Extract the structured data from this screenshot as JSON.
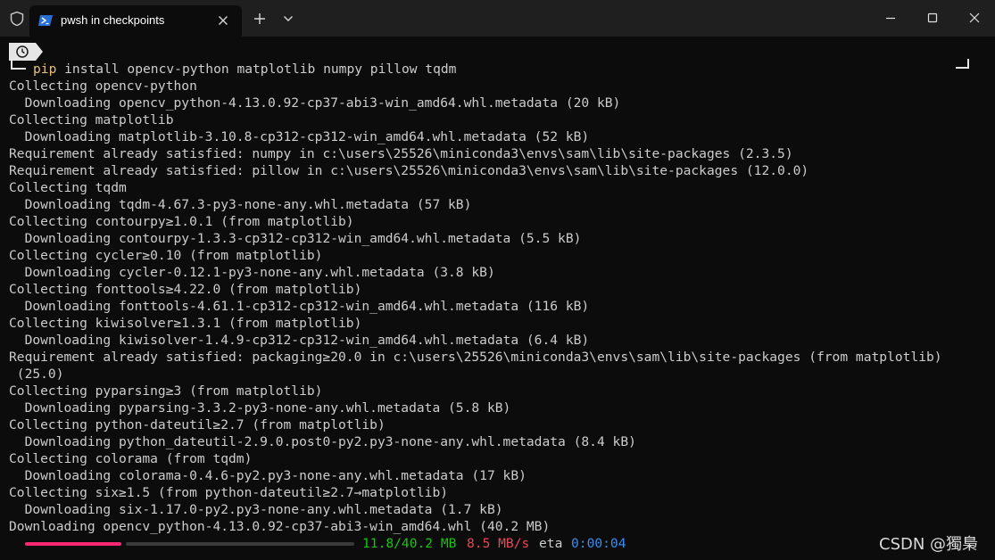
{
  "window": {
    "tab_title": "pwsh in checkpoints"
  },
  "icons": {
    "shield": "shield-icon",
    "tab": "powershell-icon",
    "tab_close": "close-icon",
    "new_tab": "plus-icon",
    "dropdown": "chevron-down-icon",
    "minimize": "minimize-icon",
    "maximize": "maximize-icon",
    "close": "close-icon",
    "prompt": "clock-icon"
  },
  "colors": {
    "background": "#0c0c0c",
    "titlebar": "#1f1f1f",
    "text": "#cccccc",
    "command_keyword": "#e5c07b",
    "progress_done": "#f92672",
    "downloaded": "#16c60c",
    "speed": "#e74856",
    "eta": "#3b8eea"
  },
  "terminal": {
    "command_keyword": "pip",
    "command_rest": " install opencv-python matplotlib numpy pillow tqdm",
    "lines": [
      "Collecting opencv-python",
      "  Downloading opencv_python-4.13.0.92-cp37-abi3-win_amd64.whl.metadata (20 kB)",
      "Collecting matplotlib",
      "  Downloading matplotlib-3.10.8-cp312-cp312-win_amd64.whl.metadata (52 kB)",
      "Requirement already satisfied: numpy in c:\\users\\25526\\miniconda3\\envs\\sam\\lib\\site-packages (2.3.5)",
      "Requirement already satisfied: pillow in c:\\users\\25526\\miniconda3\\envs\\sam\\lib\\site-packages (12.0.0)",
      "Collecting tqdm",
      "  Downloading tqdm-4.67.3-py3-none-any.whl.metadata (57 kB)",
      "Collecting contourpy≥1.0.1 (from matplotlib)",
      "  Downloading contourpy-1.3.3-cp312-cp312-win_amd64.whl.metadata (5.5 kB)",
      "Collecting cycler≥0.10 (from matplotlib)",
      "  Downloading cycler-0.12.1-py3-none-any.whl.metadata (3.8 kB)",
      "Collecting fonttools≥4.22.0 (from matplotlib)",
      "  Downloading fonttools-4.61.1-cp312-cp312-win_amd64.whl.metadata (116 kB)",
      "Collecting kiwisolver≥1.3.1 (from matplotlib)",
      "  Downloading kiwisolver-1.4.9-cp312-cp312-win_amd64.whl.metadata (6.4 kB)",
      "Requirement already satisfied: packaging≥20.0 in c:\\users\\25526\\miniconda3\\envs\\sam\\lib\\site-packages (from matplotlib)",
      " (25.0)",
      "Collecting pyparsing≥3 (from matplotlib)",
      "  Downloading pyparsing-3.3.2-py3-none-any.whl.metadata (5.8 kB)",
      "Collecting python-dateutil≥2.7 (from matplotlib)",
      "  Downloading python_dateutil-2.9.0.post0-py2.py3-none-any.whl.metadata (8.4 kB)",
      "Collecting colorama (from tqdm)",
      "  Downloading colorama-0.4.6-py2.py3-none-any.whl.metadata (17 kB)",
      "Collecting six≥1.5 (from python-dateutil≥2.7→matplotlib)",
      "  Downloading six-1.17.0-py2.py3-none-any.whl.metadata (1.7 kB)",
      "Downloading opencv_python-4.13.0.92-cp37-abi3-win_amd64.whl (40.2 MB)"
    ],
    "progress": {
      "fraction": 0.293,
      "downloaded": "11.8/40.2 MB",
      "speed": "8.5 MB/s",
      "eta_label": "eta",
      "eta": "0:00:04"
    }
  },
  "watermark": "CSDN @獨梟"
}
